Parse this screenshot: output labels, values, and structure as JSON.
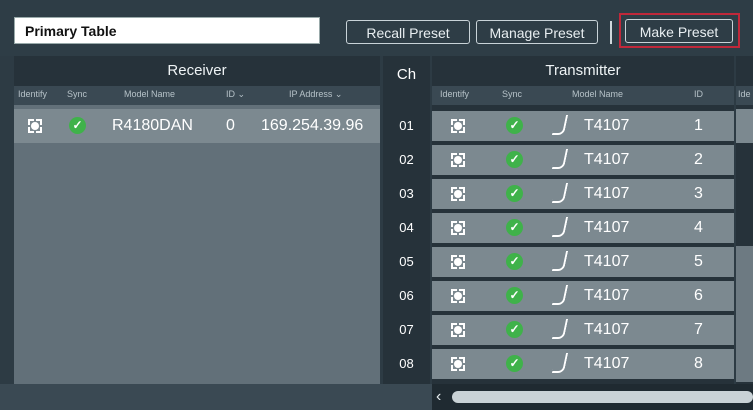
{
  "top": {
    "table_name": "Primary Table",
    "recall_label": "Recall Preset",
    "manage_label": "Manage Preset",
    "make_label": "Make Preset"
  },
  "receiver": {
    "title": "Receiver",
    "headers": {
      "identify": "Identify",
      "sync": "Sync",
      "model": "Model Name",
      "id": "ID",
      "ip": "IP Address"
    },
    "row": {
      "model": "R4180DAN",
      "id": "0",
      "ip": "169.254.39.96"
    }
  },
  "ch_title": "Ch",
  "transmitter": {
    "title": "Transmitter",
    "headers": {
      "identify": "Identify",
      "sync": "Sync",
      "model": "Model Name",
      "id": "ID",
      "extra": "Ide"
    },
    "rows": [
      {
        "ch": "01",
        "model": "T4107",
        "id": "1"
      },
      {
        "ch": "02",
        "model": "T4107",
        "id": "2"
      },
      {
        "ch": "03",
        "model": "T4107",
        "id": "3"
      },
      {
        "ch": "04",
        "model": "T4107",
        "id": "4"
      },
      {
        "ch": "05",
        "model": "T4107",
        "id": "5"
      },
      {
        "ch": "06",
        "model": "T4107",
        "id": "6"
      },
      {
        "ch": "07",
        "model": "T4107",
        "id": "7"
      },
      {
        "ch": "08",
        "model": "T4107",
        "id": "8"
      }
    ]
  },
  "icons": {
    "identify": "identify-icon",
    "sync": "sync-check-icon",
    "transmitter": "handheld-mic-icon",
    "scroll_left": "chevron-left-icon"
  },
  "colors": {
    "highlight": "#c0283a",
    "sync": "#3fb24a"
  }
}
